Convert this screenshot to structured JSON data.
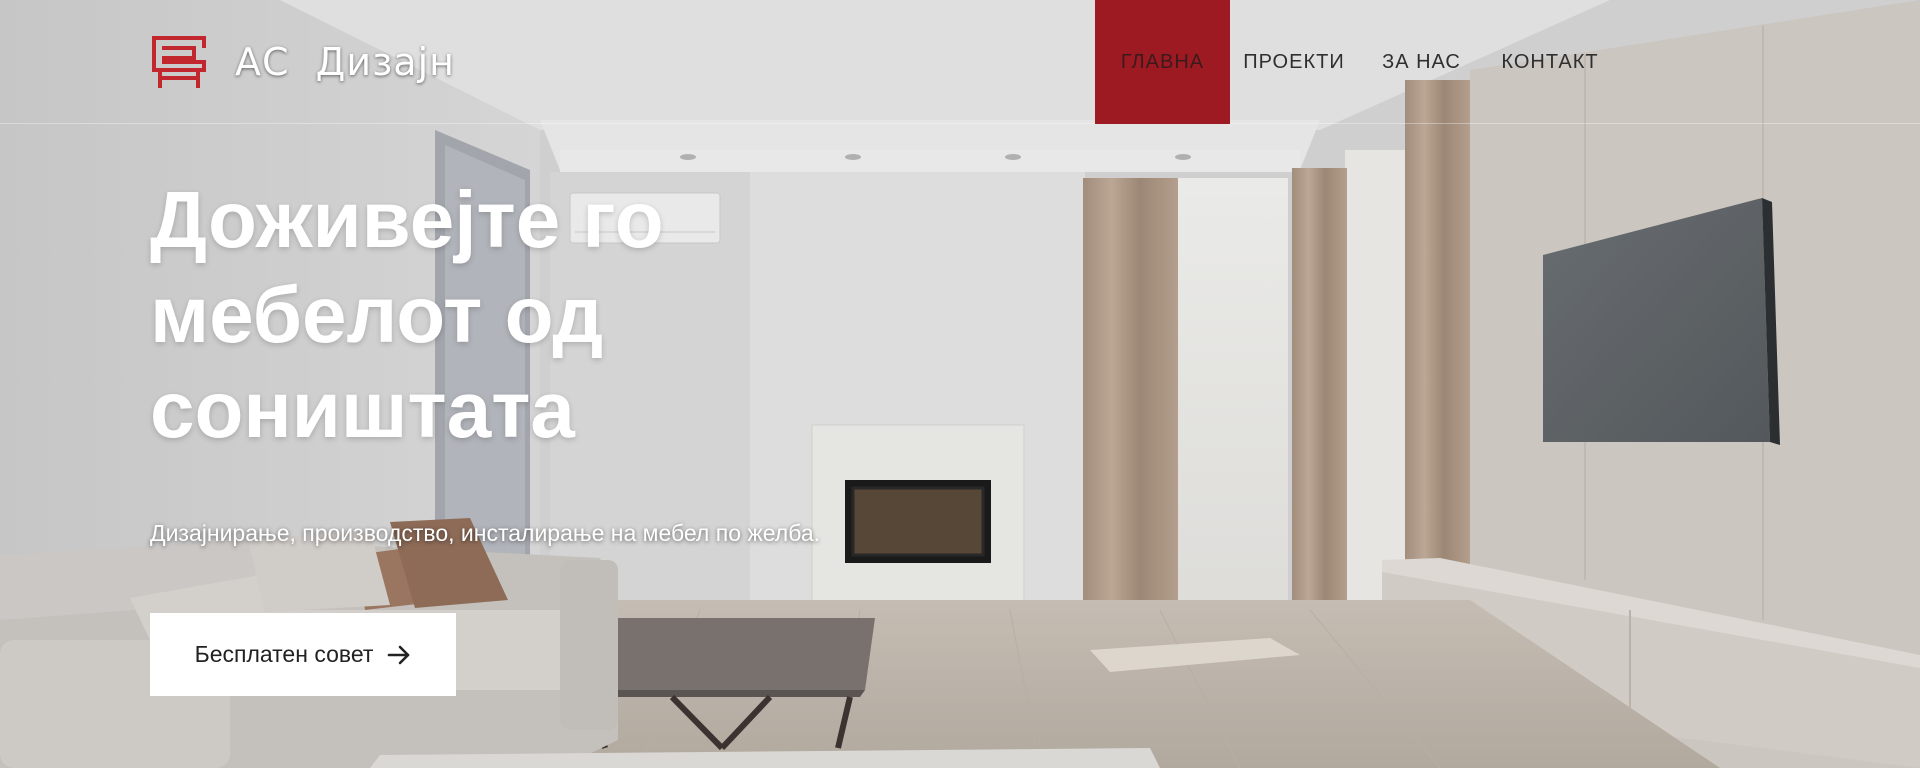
{
  "brand": {
    "name": "АС  Дизајн",
    "logo_icon": "sofa-logo-icon",
    "accent_color": "#9e1a22"
  },
  "nav": {
    "items": [
      {
        "label": "ГЛАВНА",
        "active": true
      },
      {
        "label": "ПРОЕКТИ",
        "active": false
      },
      {
        "label": "ЗА НАС",
        "active": false
      },
      {
        "label": "КОНТАКТ",
        "active": false
      }
    ]
  },
  "hero": {
    "headline": "Доживејте го мебелот од соништата",
    "subline": "Дизајнирање, производство, инсталирање на мебел по желба.",
    "cta_label": "Бесплатен совет",
    "cta_icon": "arrow-right-icon",
    "background": "living-room-interior-photo"
  }
}
